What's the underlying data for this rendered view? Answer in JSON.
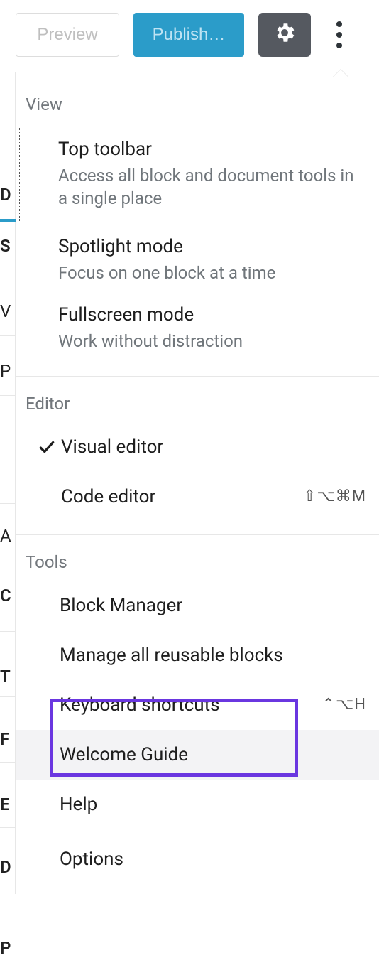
{
  "toolbar": {
    "preview_label": "Preview",
    "publish_label": "Publish…"
  },
  "dropdown": {
    "view": {
      "label": "View",
      "items": [
        {
          "title": "Top toolbar",
          "desc": "Access all block and document tools in a single place"
        },
        {
          "title": "Spotlight mode",
          "desc": "Focus on one block at a time"
        },
        {
          "title": "Fullscreen mode",
          "desc": "Work without distraction"
        }
      ]
    },
    "editor": {
      "label": "Editor",
      "items": [
        {
          "title": "Visual editor",
          "checked": true,
          "shortcut": ""
        },
        {
          "title": "Code editor",
          "checked": false,
          "shortcut": "⇧⌥⌘M"
        }
      ]
    },
    "tools": {
      "label": "Tools",
      "items": [
        {
          "title": "Block Manager",
          "shortcut": ""
        },
        {
          "title": "Manage all reusable blocks",
          "shortcut": ""
        },
        {
          "title": "Keyboard shortcuts",
          "shortcut": "⌃⌥H"
        },
        {
          "title": "Welcome Guide",
          "shortcut": "",
          "highlighted": true
        },
        {
          "title": "Help",
          "shortcut": ""
        },
        {
          "title": "Options",
          "shortcut": ""
        }
      ]
    }
  },
  "bg_letters": {
    "d": "D",
    "s": "S",
    "v": "V",
    "p": "P",
    "a": "A",
    "c": "C",
    "t": "T",
    "f": "F",
    "e": "E",
    "d2": "D",
    "p2": "P"
  }
}
